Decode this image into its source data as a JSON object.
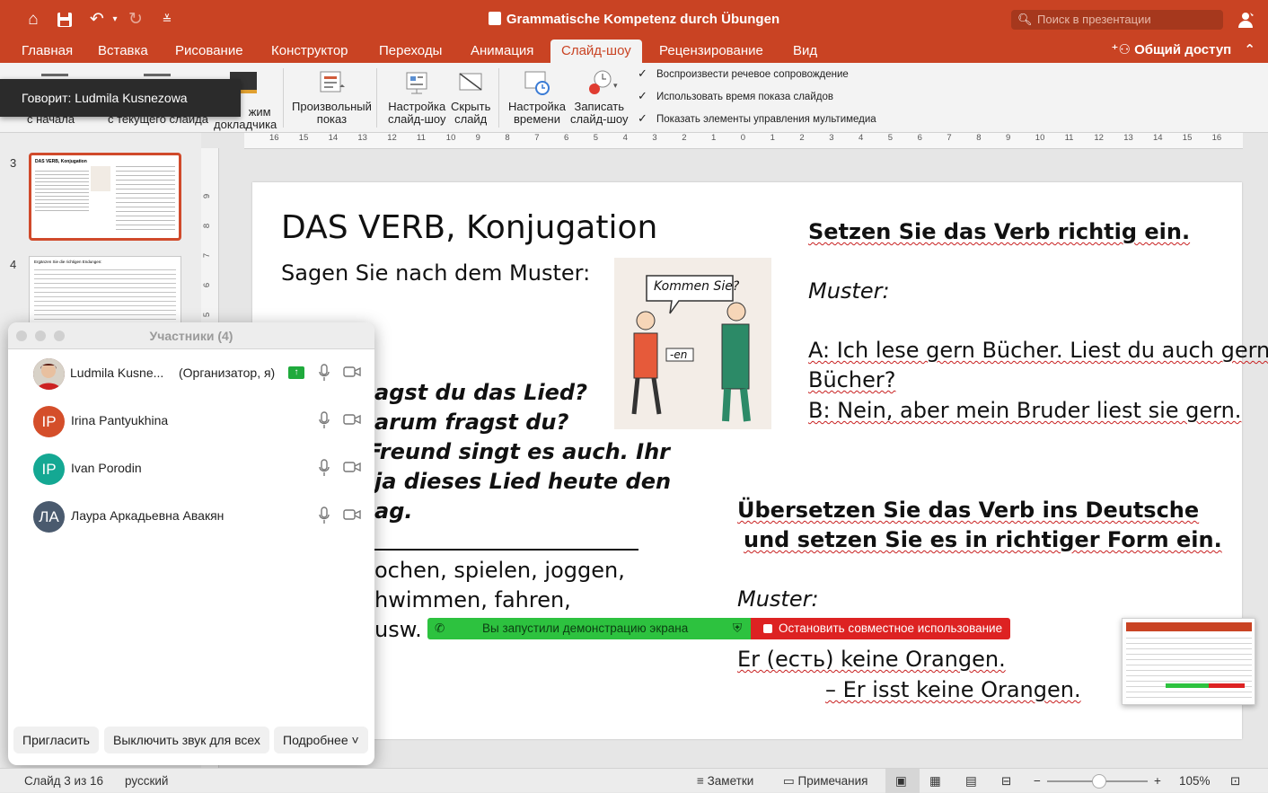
{
  "app": {
    "document_title": "Grammatische Kompetenz durch Übungen",
    "search_placeholder": "Поиск в презентации",
    "share_label": "Общий доступ"
  },
  "tabs": [
    "Главная",
    "Вставка",
    "Рисование",
    "Конструктор",
    "Переходы",
    "Анимация",
    "Слайд-шоу",
    "Рецензирование",
    "Вид"
  ],
  "active_tab": "Слайд-шоу",
  "ribbon": {
    "btn_from_start": "с начала",
    "btn_from_current": "с текущего слайда",
    "btn_presenter_1": "жим",
    "btn_presenter_2": "докладчика",
    "btn_custom_1": "Произвольный",
    "btn_custom_2": "показ",
    "btn_setup_1": "Настройка",
    "btn_setup_2": "слайд-шоу",
    "btn_hide_1": "Скрыть",
    "btn_hide_2": "слайд",
    "btn_rehearse_1": "Настройка",
    "btn_rehearse_2": "времени",
    "btn_record_1": "Записать",
    "btn_record_2": "слайд-шоу",
    "check_narration": "Воспроизвести речевое сопровождение",
    "check_timings": "Использовать время показа слайдов",
    "check_media_controls": "Показать элементы управления мультимедиа"
  },
  "speaking_banner": "Говорит: Ludmila Kusnezowa",
  "thumbnails": {
    "num3": "3",
    "num4": "4",
    "t3_title": "DAS VERB, Konjugation",
    "t4_title": "Ergänzen Sie die richtigen Endungen:"
  },
  "ruler_labels": [
    "16",
    "15",
    "14",
    "13",
    "12",
    "11",
    "10",
    "9",
    "8",
    "7",
    "6",
    "5",
    "4",
    "3",
    "2",
    "1",
    "0",
    "1",
    "2",
    "3",
    "4",
    "5",
    "6",
    "7",
    "8",
    "9",
    "10",
    "11",
    "12",
    "13",
    "14",
    "15",
    "16"
  ],
  "vruler_labels": [
    "9",
    "8",
    "7",
    "6",
    "5"
  ],
  "slide": {
    "title": "DAS VERB, Konjugation",
    "subtitle": "Sagen Sie nach dem Muster:",
    "bubble": "Kommen Sie?",
    "card": "-en",
    "q_line1": "agst du das Lied?",
    "q_line2": "arum fragst du?",
    "q_line3": "Freund singt es auch. Ihr",
    "q_line4": "ja dieses Lied heute den",
    "q_line5": "ag.",
    "verbs_line1": "ochen, spielen, joggen,",
    "verbs_line2": "hwimmen, fahren,",
    "verbs_line3": "usw.",
    "right_heading": "Setzen Sie das Verb richtig ein.",
    "muster1": "Muster:",
    "example_a1": "A: Ich lese gern Bücher. Liest du auch gern",
    "example_a2": "Bücher?",
    "example_b": "B: Nein, aber mein Bruder liest sie gern.",
    "translate_1": "Übersetzen Sie das Verb ins Deutsche",
    "translate_2": "und setzen Sie es in richtiger Form ein.",
    "muster2": "Muster:",
    "example_ru": "Er (есть) keine Orangen.",
    "example_de": "– Er isst keine Orangen."
  },
  "status": {
    "slide_counter": "Слайд 3 из 16",
    "language": "русский",
    "notes": "Заметки",
    "comments": "Примечания",
    "zoom": "105%"
  },
  "participants": {
    "title": "Участники (4)",
    "list": [
      {
        "name": "Ludmila Kusne...",
        "role": "(Организатор, я)",
        "initials": "",
        "color": "#8a2a1a"
      },
      {
        "name": "Irina Pantyukhina",
        "role": "",
        "initials": "IP",
        "color": "#d44e2a"
      },
      {
        "name": "Ivan Porodin",
        "role": "",
        "initials": "IP",
        "color": "#14a893"
      },
      {
        "name": "Лаура Аркадьевна Авакян",
        "role": "",
        "initials": "ЛА",
        "color": "#4a5a6e"
      }
    ],
    "invite": "Пригласить",
    "mute_all": "Выключить звук для всех",
    "more": "Подробнее"
  },
  "share_bar": {
    "status": "Вы запустили демонстрацию экрана",
    "stop": "Остановить совместное использование"
  },
  "colors": {
    "accent": "#c94323",
    "share_green": "#2dc23f",
    "stop_red": "#dd2222"
  }
}
